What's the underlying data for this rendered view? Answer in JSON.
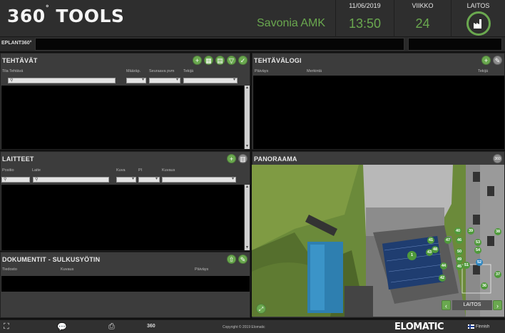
{
  "header": {
    "logo": "360",
    "logo_rest": "TOOLS",
    "organization": "Savonia AMK",
    "date": "11/06/2019",
    "time": "13:50",
    "week_label": "VIIKKO",
    "week": "24",
    "plant_label": "LAITOS"
  },
  "eplant": {
    "label": "EPLANT360°"
  },
  "tasks": {
    "title": "TEHTÄVÄT",
    "columns": [
      "Tila Tehtävä",
      "Määräp.",
      "Seuraava pvm",
      "Tekijä"
    ]
  },
  "tasklog": {
    "title": "TEHTÄVÄLOGI",
    "columns": [
      "Päiväys",
      "Merkintä",
      "Tekijä"
    ]
  },
  "devices": {
    "title": "LAITTEET",
    "columns": [
      "Positio",
      "Laite",
      "Kuva",
      "PI",
      "Kuvaus"
    ]
  },
  "documents": {
    "title": "DOKUMENTIT - SULKUSYÖTIN",
    "columns": [
      "Tiedosto",
      "Kuvaus",
      "Päiväys"
    ]
  },
  "panorama": {
    "title": "PANORAAMA",
    "badge": "360",
    "plant_button": "LAITOS",
    "markers": [
      "1",
      "41",
      "43",
      "48",
      "47",
      "46",
      "40",
      "39",
      "38",
      "53",
      "54",
      "50",
      "49",
      "44",
      "45",
      "51",
      "52",
      "42",
      "37",
      "36"
    ]
  },
  "footer": {
    "label_360": "360",
    "copyright": "Copyright © 2019 Elomatic",
    "brand": "ELOMATIC",
    "language": "Finnish"
  },
  "colors": {
    "accent": "#6aa84f",
    "panel": "#3c3c3c",
    "list": "#000000"
  }
}
